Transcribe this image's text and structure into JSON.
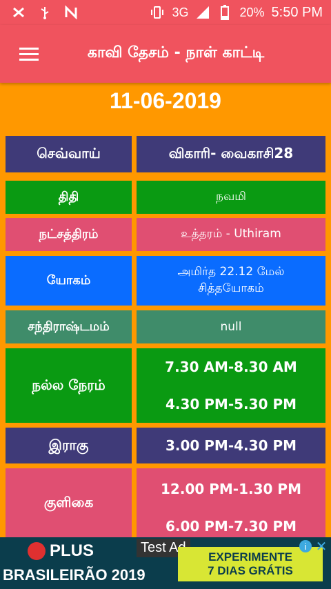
{
  "status_bar": {
    "signal_text": "3G",
    "battery": "20%",
    "time": "5:50 PM",
    "icons": [
      "shuffle-icon",
      "usb-icon",
      "n-icon",
      "vibrate-icon",
      "signal-icon",
      "battery-icon"
    ]
  },
  "app_bar": {
    "title": "காவி தேசம் - நாள் காட்டி"
  },
  "date": "11-06-2019",
  "rows": {
    "day": {
      "left": "செவ்வாய்",
      "right": "விகாரி-  வைகாசி28"
    },
    "thithi": {
      "label": "திதி",
      "value": "நவமி"
    },
    "nakshatram": {
      "label": "நட்சத்திரம்",
      "value": "உத்தரம் - Uthiram"
    },
    "yogam": {
      "label": "யோகம்",
      "value_line1": "அமிர்த 22.12   மேல்",
      "value_line2": "சித்தயோகம்"
    },
    "chandrashtamam": {
      "label": "சந்திராஷ்டமம்",
      "value": "null"
    },
    "nalla_neram": {
      "label": "நல்ல நேரம்",
      "value_line1": "7.30 AM-8.30 AM",
      "value_line2": "4.30 PM-5.30 PM"
    },
    "raagu": {
      "label": "இராகு",
      "value": "3.00 PM-4.30 PM"
    },
    "kuligai": {
      "label": "குளிகை",
      "value_line1": "12.00 PM-1.30 PM",
      "value_line2": "6.00 PM-7.30 PM"
    }
  },
  "ad": {
    "brand": "PLUS",
    "subtitle": "BRASILEIRÃO 2019",
    "label": "Test Ad",
    "cta_line1": "EXPERIMENTE",
    "cta_line2": "7 DIAS GRÁTIS",
    "info": "i",
    "close": "✕"
  },
  "colors": {
    "background": "#ff9800",
    "app_bar": "#f0535e",
    "navy": "#3f3a78",
    "green": "#0a9a12",
    "pink": "#e04f72",
    "blue": "#0a6cff",
    "teal": "#3f8c6a"
  }
}
